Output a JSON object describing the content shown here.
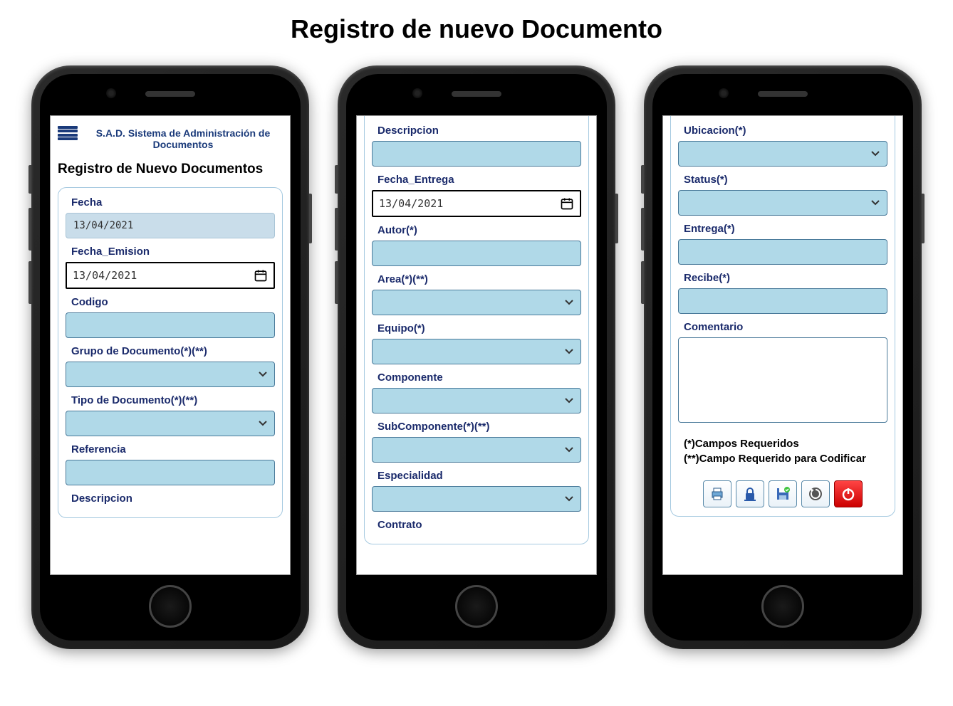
{
  "pageTitle": "Registro de nuevo Documento",
  "app": {
    "title": "S.A.D. Sistema de Administración de Documentos",
    "subtitle": "Registro de Nuevo Documentos"
  },
  "phone1": {
    "fields": {
      "fecha": {
        "label": "Fecha",
        "value": "13/04/2021"
      },
      "fechaEmision": {
        "label": "Fecha_Emision",
        "value": "13/04/2021"
      },
      "codigo": {
        "label": "Codigo",
        "value": ""
      },
      "grupoDocumento": {
        "label": "Grupo de Documento(*)(**)",
        "value": ""
      },
      "tipoDocumento": {
        "label": "Tipo de Documento(*)(**)",
        "value": ""
      },
      "referencia": {
        "label": "Referencia",
        "value": ""
      },
      "descripcion": {
        "label": "Descripcion"
      }
    }
  },
  "phone2": {
    "fields": {
      "descripcion": {
        "label": "Descripcion",
        "value": ""
      },
      "fechaEntrega": {
        "label": "Fecha_Entrega",
        "value": "13/04/2021"
      },
      "autor": {
        "label": "Autor(*)",
        "value": ""
      },
      "area": {
        "label": "Area(*)(**)",
        "value": ""
      },
      "equipo": {
        "label": "Equipo(*)",
        "value": ""
      },
      "componente": {
        "label": "Componente",
        "value": ""
      },
      "subComponente": {
        "label": "SubComponente(*)(**)",
        "value": ""
      },
      "especialidad": {
        "label": "Especialidad",
        "value": ""
      },
      "contrato": {
        "label": "Contrato"
      }
    }
  },
  "phone3": {
    "fields": {
      "ubicacion": {
        "label": "Ubicacion(*)",
        "value": ""
      },
      "status": {
        "label": "Status(*)",
        "value": ""
      },
      "entrega": {
        "label": "Entrega(*)",
        "value": ""
      },
      "recibe": {
        "label": "Recibe(*)",
        "value": ""
      },
      "comentario": {
        "label": "Comentario",
        "value": ""
      }
    },
    "legend": {
      "line1": "(*)Campos Requeridos",
      "line2": "(**)Campo Requerido para Codificar"
    }
  }
}
